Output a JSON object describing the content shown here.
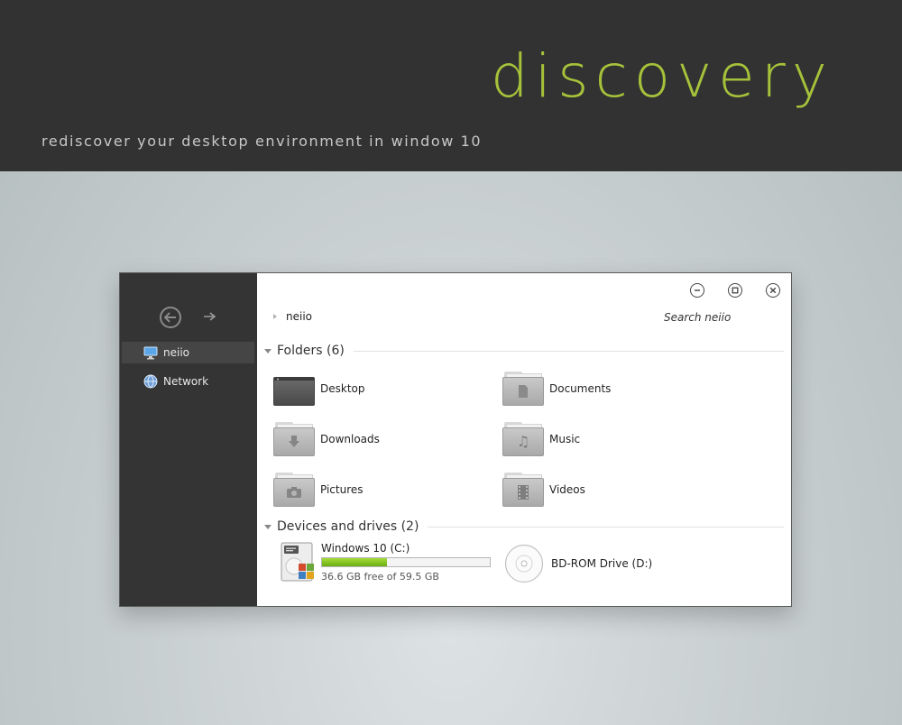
{
  "banner": {
    "brand": "discovery",
    "tagline": "rediscover your desktop environment in window 10"
  },
  "colors": {
    "accent": "#a6c23a",
    "banner_bg": "#323232",
    "sidebar_bg": "#343434",
    "progress": "#8bc926"
  },
  "sidebar": {
    "nav": {
      "back_icon": "back-arrow-circle-icon",
      "forward_icon": "forward-arrow-icon"
    },
    "items": [
      {
        "label": "neiio",
        "icon": "computer-icon",
        "selected": true
      },
      {
        "label": "Network",
        "icon": "network-globe-icon",
        "selected": false
      }
    ]
  },
  "window_controls": {
    "minimize": "minimize-icon",
    "maximize": "maximize-icon",
    "close": "close-icon"
  },
  "address": {
    "breadcrumb": "neiio",
    "search_placeholder": "Search neiio"
  },
  "folders": {
    "header": "Folders (6)",
    "items": [
      {
        "label": "Desktop",
        "icon": "desktop-folder-icon"
      },
      {
        "label": "Documents",
        "icon": "documents-folder-icon"
      },
      {
        "label": "Downloads",
        "icon": "downloads-folder-icon"
      },
      {
        "label": "Music",
        "icon": "music-folder-icon"
      },
      {
        "label": "Pictures",
        "icon": "pictures-folder-icon"
      },
      {
        "label": "Videos",
        "icon": "videos-folder-icon"
      }
    ]
  },
  "devices": {
    "header": "Devices and drives (2)",
    "items": [
      {
        "label": "Windows 10 (C:)",
        "free": "36.6 GB free of 59.5 GB",
        "used_fraction": 0.385,
        "icon": "hard-drive-icon"
      },
      {
        "label": "BD-ROM Drive (D:)",
        "icon": "optical-disc-icon"
      }
    ]
  }
}
